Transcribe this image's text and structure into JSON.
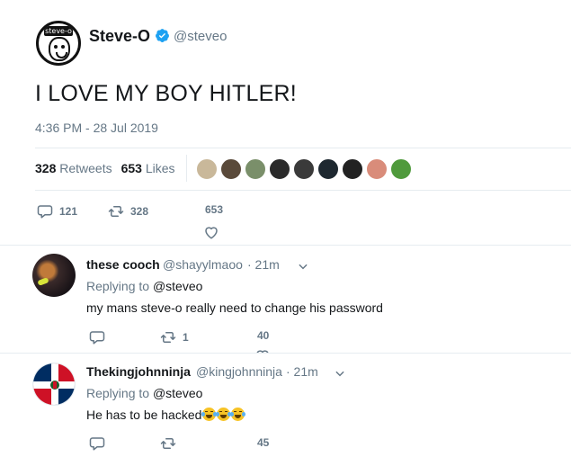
{
  "tweet": {
    "author_name": "Steve-O",
    "author_handle": "@steveo",
    "avatar_tag": "steve-o",
    "text": "I LOVE MY BOY HITLER!",
    "timestamp": "4:36 PM - 28 Jul 2019",
    "retweets_count": "328",
    "retweets_label": "Retweets",
    "likes_count": "653",
    "likes_label": "Likes",
    "liker_colors": [
      "#c9b89a",
      "#5a4a3a",
      "#7a8f6a",
      "#2b2b2b",
      "#3a3a3a",
      "#1e2830",
      "#222222",
      "#d98c7a",
      "#4f9a3c"
    ],
    "actions": {
      "replies": "121",
      "retweets": "328",
      "likes": "653"
    }
  },
  "replies": [
    {
      "name": "these cooch",
      "handle": "@shayylmaoo",
      "time": "· 21m",
      "replying_prefix": "Replying to",
      "replying_to": "@steveo",
      "text": "my mans steve-o really need to change his password",
      "actions": {
        "replies": "",
        "retweets": "1",
        "likes": "40"
      }
    },
    {
      "name": "Thekingjohnninja",
      "handle": "@kingjohnninja",
      "time": "· 21m",
      "replying_prefix": "Replying to",
      "replying_to": "@steveo",
      "text": "He has to be hacked",
      "emoji_count": 3,
      "actions": {
        "replies": "",
        "retweets": "",
        "likes": "45"
      }
    }
  ],
  "colors": {
    "text": "#14171a",
    "secondary": "#657786",
    "verified": "#1da1f2",
    "divider": "#e6ecf0"
  }
}
